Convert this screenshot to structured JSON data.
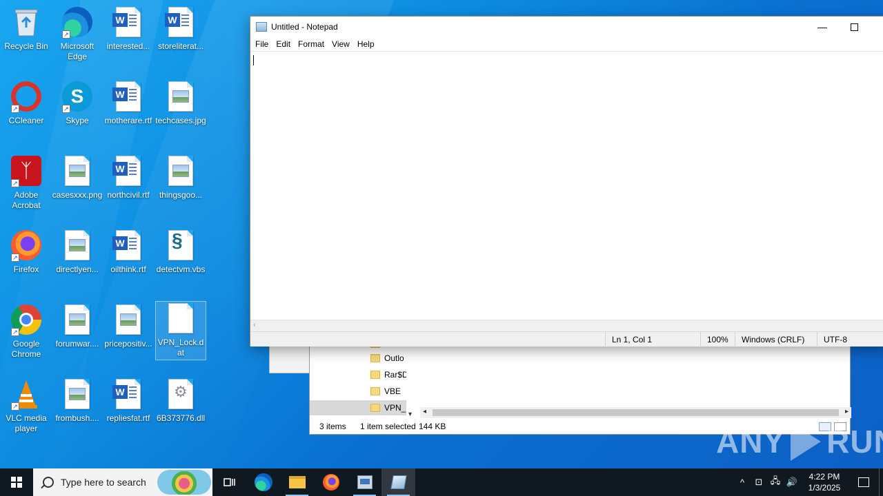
{
  "desktop": {
    "icons": [
      {
        "label": "Recycle Bin"
      },
      {
        "label": "Microsoft Edge"
      },
      {
        "label": "interested..."
      },
      {
        "label": "storeliterat..."
      },
      {
        "label": "CCleaner"
      },
      {
        "label": "Skype"
      },
      {
        "label": "motherare.rtf"
      },
      {
        "label": "techcases.jpg"
      },
      {
        "label": "Adobe Acrobat"
      },
      {
        "label": "casesxxx.png"
      },
      {
        "label": "northcivil.rtf"
      },
      {
        "label": "thingsgoo..."
      },
      {
        "label": "Firefox"
      },
      {
        "label": "directlyen..."
      },
      {
        "label": "oilthink.rtf"
      },
      {
        "label": "detectvm.vbs"
      },
      {
        "label": "Google Chrome"
      },
      {
        "label": "forumwar...."
      },
      {
        "label": "pricepositiv..."
      },
      {
        "label": "VPN_Lock.dat"
      },
      {
        "label": "VLC media player"
      },
      {
        "label": "frombush...."
      },
      {
        "label": "repliesfat.rtf"
      },
      {
        "label": "6B373776.dll"
      }
    ]
  },
  "notepad": {
    "title": "Untitled - Notepad",
    "menu": [
      "File",
      "Edit",
      "Format",
      "View",
      "Help"
    ],
    "status": {
      "position": "Ln 1, Col 1",
      "zoom": "100%",
      "line_ending": "Windows (CRLF)",
      "encoding": "UTF-8"
    }
  },
  "explorer": {
    "tree": [
      "Outlo",
      "Rar$D",
      "VBE",
      "VPN_"
    ],
    "status": {
      "items": "3 items",
      "selected": "1 item selected",
      "size": "144 KB"
    }
  },
  "watermark": {
    "text_left": "ANY",
    "text_right": "RUN"
  },
  "taskbar": {
    "search_placeholder": "Type here to search",
    "time": "4:22 PM",
    "date": "1/3/2025"
  }
}
